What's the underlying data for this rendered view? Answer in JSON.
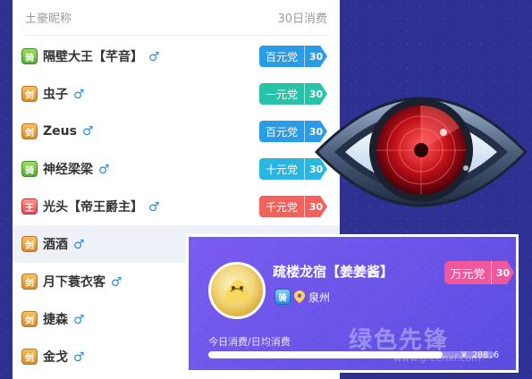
{
  "panel": {
    "header_left": "土豪昵称",
    "header_right": "30日消费",
    "male_symbol": "♂",
    "rows": [
      {
        "badge": "骑",
        "badge_style": "green",
        "name": "隔壁大王【芊音】",
        "tag": "百元党",
        "level": "30",
        "tag_color": "blue"
      },
      {
        "badge": "剑",
        "badge_style": "gold",
        "name": "虫子",
        "tag": "一元党",
        "level": "30",
        "tag_color": "teal"
      },
      {
        "badge": "剑",
        "badge_style": "gold",
        "name": "Zeus",
        "tag": "百元党",
        "level": "30",
        "tag_color": "blue"
      },
      {
        "badge": "骑",
        "badge_style": "green",
        "name": "神经梁梁",
        "tag": "十元党",
        "level": "30",
        "tag_color": "cyan"
      },
      {
        "badge": "王",
        "badge_style": "red",
        "name": "光头【帝王爵主】",
        "tag": "千元党",
        "level": "30",
        "tag_color": "red"
      },
      {
        "badge": "剑",
        "badge_style": "gold",
        "name": "酒酒",
        "tag": "",
        "level": "",
        "tag_color": "teal"
      },
      {
        "badge": "剑",
        "badge_style": "gold",
        "name": "月下蓑衣客",
        "tag": "",
        "level": "",
        "tag_color": "blue"
      },
      {
        "badge": "剑",
        "badge_style": "gold",
        "name": "捷森",
        "tag": "",
        "level": "",
        "tag_color": "blue"
      },
      {
        "badge": "剑",
        "badge_style": "gold",
        "name": "金戈",
        "tag": "",
        "level": "",
        "tag_color": "blue"
      }
    ]
  },
  "card": {
    "name": "疏楼龙宿【姜姜酱】",
    "badge": "骑",
    "city": "泉州",
    "tag": "万元党",
    "level": "30",
    "spend_label": "今日消费/日均消费",
    "amount": "¥ 208.6",
    "progress": 0.82
  },
  "watermark": {
    "text": "绿色先锋",
    "url": "www.greenxf.com"
  },
  "colors": {
    "background": "#2f3192",
    "card": "#6a55ea",
    "tag_blue": "#2c9be6",
    "tag_teal": "#27c3a8",
    "tag_cyan": "#29b6e1",
    "tag_red": "#f2615c",
    "tag_pink": "#f25a9c"
  }
}
